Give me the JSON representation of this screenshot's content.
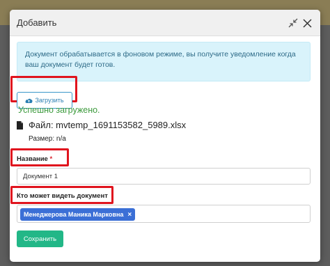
{
  "modal": {
    "title": "Добавить",
    "minimize_icon": "collapse-arrows-icon",
    "close_icon": "close-icon"
  },
  "info": {
    "text": "Документ обрабатывается в фоновом режиме, вы получите уведомление когда ваш документ будет готов."
  },
  "upload": {
    "icon": "cloud-upload-icon",
    "label": "Загрузить",
    "status": "Успешно загружено."
  },
  "file": {
    "icon": "file-icon",
    "name": "Файл: mvtemp_1691153582_5989.xlsx",
    "size": "Размер: n/a"
  },
  "name_field": {
    "label": "Название",
    "required_mark": "*",
    "value": "Документ 1"
  },
  "visibility_field": {
    "label": "Кто может видеть документ",
    "tags": [
      {
        "label": "Менеджерова Маника Марковна",
        "remove": "×"
      }
    ]
  },
  "actions": {
    "save_label": "Сохранить"
  },
  "colors": {
    "highlight": "#e0141e",
    "primary": "#22b787",
    "tag": "#3b6fd6",
    "success": "#3c9a3c",
    "info_bg": "#d9f3fb"
  }
}
